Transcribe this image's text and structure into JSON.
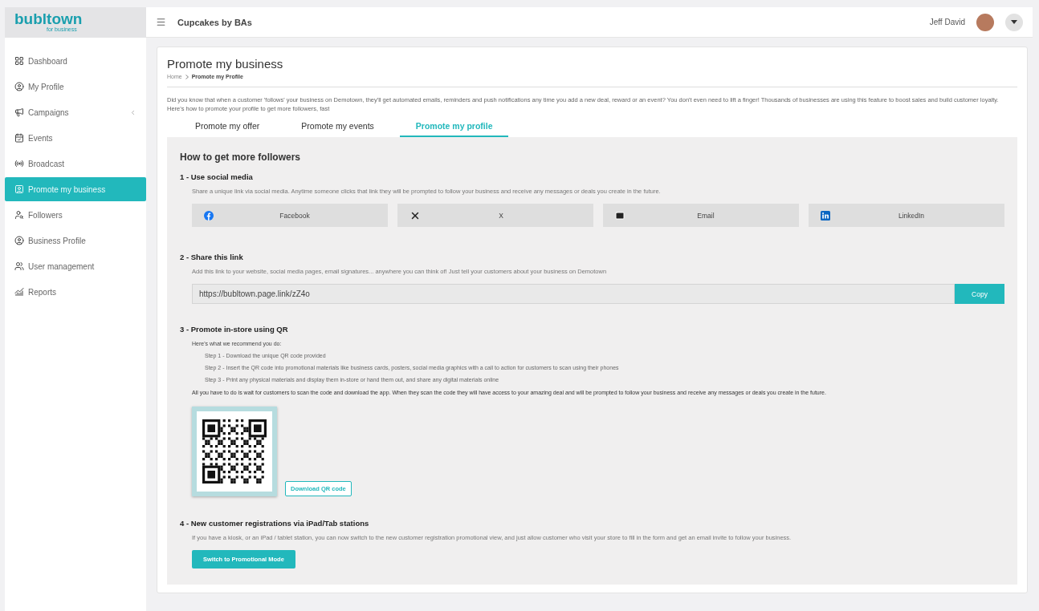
{
  "sidebar": {
    "logo": "bubltown",
    "logo_sub": "for business",
    "items": [
      {
        "label": "Dashboard",
        "selected": false
      },
      {
        "label": "My Profile",
        "selected": false
      },
      {
        "label": "Campaigns",
        "selected": false,
        "expanded": false
      },
      {
        "label": "Events",
        "selected": false
      },
      {
        "label": "Broadcast",
        "selected": false
      },
      {
        "label": "Promote my business",
        "selected": true
      },
      {
        "label": "Followers",
        "selected": false
      },
      {
        "label": "Business Profile",
        "selected": false
      },
      {
        "label": "User management",
        "selected": false
      },
      {
        "label": "Reports",
        "selected": false
      }
    ]
  },
  "header": {
    "title": "Cupcakes by BAs",
    "user": "Jeff David"
  },
  "page": {
    "title": "Promote my business",
    "breadcrumb": [
      "Home",
      "Promote my Profile"
    ],
    "intro": "Did you know that when a customer 'follows' your business on Demotown, they'll get automated emails, reminders and push notifications any time you add a new deal, reward or an event? You don't even need to lift a finger! Thousands of businesses are using this feature to boost sales and build customer loyalty. Here's how to promote your profile to get more followers, fast",
    "tabs": [
      {
        "label": "Promote my offer",
        "selected": false
      },
      {
        "label": "Promote my events",
        "selected": false
      },
      {
        "label": "Promote my profile",
        "selected": true
      }
    ]
  },
  "panel": {
    "title": "How to get more followers",
    "social": {
      "heading": "1 - Use social media",
      "text": "Share a unique link via social media. Anytime someone clicks that link they will be prompted to follow your business and receive any messages or deals you create in the future.",
      "buttons": [
        {
          "label": "Facebook",
          "kind": "facebook"
        },
        {
          "label": "X",
          "kind": "x"
        },
        {
          "label": "Email",
          "kind": "email"
        },
        {
          "label": "LinkedIn",
          "kind": "linkedin"
        }
      ]
    },
    "link": {
      "heading": "2 - Share this link",
      "text": "Add this link to your website, social media pages, email signatures... anywhere you can think of! Just tell your customers about your business on Demotown",
      "value": "https://bubltown.page.link/zZ4o",
      "button": "Copy"
    },
    "qr": {
      "heading": "3 - Promote in-store using QR",
      "lead": "Here's what we recommend you do:",
      "steps": [
        "Step 1 - Download the unique QR code provided",
        "Step 2 - Insert the QR code into promotional materials like business cards, posters, social media graphics with a call to action for customers to scan using their phones",
        "Step 3 - Print any physical materials and display them in-store or hand them out, and share any digital materials online"
      ],
      "note": "All you have to do is wait for customers to scan the code and download the app. When they scan the code they will have access to your amazing deal and will be prompted to follow your business and receive any messages or deals you create in the future.",
      "button": "Download QR code"
    },
    "kiosk": {
      "heading": "4 - New customer registrations via iPad/Tab stations",
      "text": "If you have a kiosk, or an iPad / tablet station, you can now switch to the new customer registration promotional view, and just allow customer who visit your store to fill in the form and get an email invite to follow your business.",
      "button": "Switch to Promotional Mode"
    }
  }
}
